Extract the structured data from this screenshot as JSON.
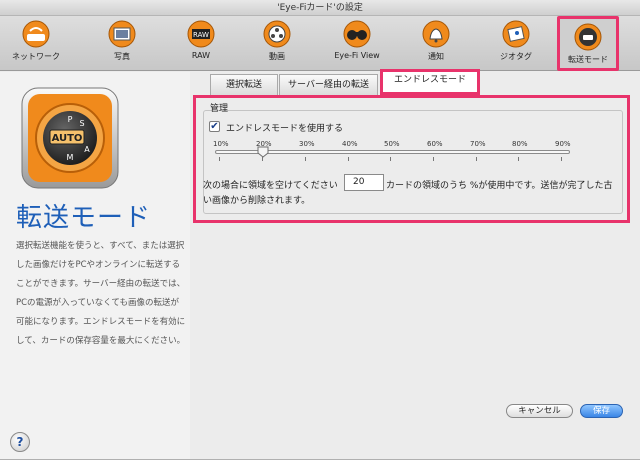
{
  "window": {
    "title": "'Eye-Fiカード'の設定"
  },
  "toolbar": {
    "items": [
      {
        "label": "ネットワーク",
        "icon": "wifi-router-icon"
      },
      {
        "label": "写真",
        "icon": "photos-icon"
      },
      {
        "label": "RAW",
        "icon": "raw-icon"
      },
      {
        "label": "動画",
        "icon": "film-reel-icon"
      },
      {
        "label": "Eye-Fi View",
        "icon": "binoculars-icon"
      },
      {
        "label": "通知",
        "icon": "bell-icon"
      },
      {
        "label": "ジオタグ",
        "icon": "map-icon"
      },
      {
        "label": "転送モード",
        "icon": "transfer-dial-icon"
      }
    ],
    "selected": "転送モード"
  },
  "sidebar": {
    "icon": "mode-dial-icon",
    "title": "転送モード",
    "description": "選択転送機能を使うと、すべて、または選択した画像だけをPCやオンラインに転送することができます。サーバー経由の転送では、PCの電源が入っていなくても画像の転送が可能になります。エンドレスモードを有効にして、カードの保存容量を最大にください。"
  },
  "tabs": [
    {
      "label": "選択転送"
    },
    {
      "label": "サーバー経由の転送"
    },
    {
      "label": "エンドレスモード"
    }
  ],
  "selected_tab": "エンドレスモード",
  "management": {
    "title": "管理",
    "checkbox_label": "エンドレスモードを使用する",
    "checkbox_checked": true,
    "slider": {
      "ticks": [
        "10%",
        "20%",
        "30%",
        "40%",
        "50%",
        "60%",
        "70%",
        "80%",
        "90%"
      ],
      "value_percent": 20
    },
    "sentence_prefix": "次の場合に領域を空けてください",
    "threshold_value": "20",
    "sentence_suffix": "カードの領域のうち %が使用中です。送信が完了した古",
    "sentence_line2": "い画像から削除されます。"
  },
  "buttons": {
    "cancel": "キャンセル",
    "save": "保存"
  },
  "help": {
    "label": "?"
  },
  "colors": {
    "highlight": "#e8336b",
    "accent_orange": "#f08a1c",
    "title_blue": "#1e5fb8"
  }
}
